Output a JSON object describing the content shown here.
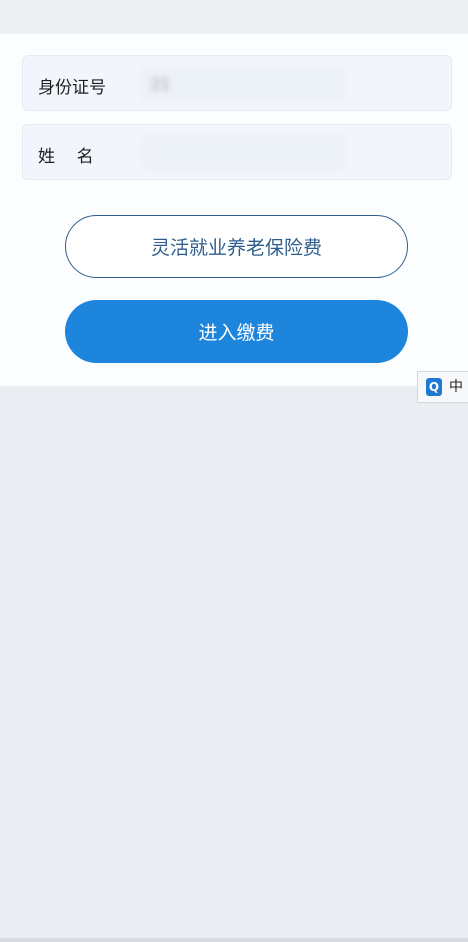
{
  "form": {
    "id_field": {
      "label": "身份证号",
      "value": "21"
    },
    "name_field": {
      "label": "姓    名",
      "value": ""
    }
  },
  "buttons": {
    "insurance_type": "灵活就业养老保险费",
    "enter_payment": "进入缴费"
  },
  "ime": {
    "logo_icon": "ime-logo-icon",
    "logo_text": "Q",
    "language": "中"
  },
  "colors": {
    "primary": "#1d86dc",
    "outline": "#2f5e8e",
    "background": "#ecedf3"
  }
}
